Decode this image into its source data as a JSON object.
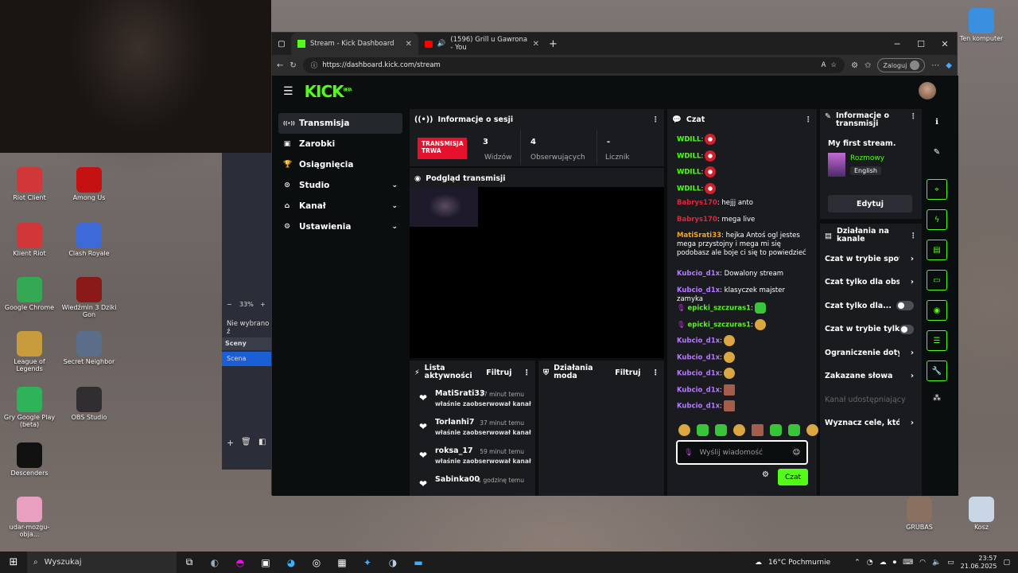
{
  "desktop": {
    "icons": [
      {
        "label": "Riot Client",
        "color": "#d13639"
      },
      {
        "label": "Among Us",
        "color": "#c51111"
      },
      {
        "label": "Klient Riot",
        "color": "#d13639"
      },
      {
        "label": "Clash Royale",
        "color": "#3d6ad6"
      },
      {
        "label": "Google Chrome",
        "color": "#34a853"
      },
      {
        "label": "Wiedźmin 3 Dziki Gon",
        "color": "#8a1a1a"
      },
      {
        "label": "League of Legends",
        "color": "#c89b3c"
      },
      {
        "label": "Secret Neighbor",
        "color": "#5a6e8a"
      },
      {
        "label": "Gry Google Play (beta)",
        "color": "#2fb35a"
      },
      {
        "label": "OBS Studio",
        "color": "#302e31"
      },
      {
        "label": "Descenders",
        "color": "#111111"
      },
      {
        "label": "udar-mozgu-obja...",
        "color": "#e9a0c0"
      },
      {
        "label": "Ten komputer",
        "color": "#3a8fe0"
      },
      {
        "label": "GRUBAS",
        "color": "#8a7060"
      },
      {
        "label": "Kosz",
        "color": "#c8d6e6"
      }
    ],
    "obs": {
      "zoom": "33%",
      "no_selection": "Nie wybrano ź",
      "scenes_label": "Sceny",
      "scene": "Scena"
    }
  },
  "browser": {
    "tabs": [
      {
        "title": "Stream - Kick Dashboard"
      },
      {
        "title": "(1596) Grill u Gawrona - You"
      }
    ],
    "url": "https://dashboard.kick.com/stream",
    "login": "Zaloguj"
  },
  "kick": {
    "logo": "KICK",
    "logo_sup": "BETA",
    "nav": [
      {
        "label": "Transmisja",
        "icon": "broadcast-icon"
      },
      {
        "label": "Zarobki",
        "icon": "wallet-icon"
      },
      {
        "label": "Osiągnięcia",
        "icon": "trophy-icon"
      },
      {
        "label": "Studio",
        "icon": "studio-icon"
      },
      {
        "label": "Kanał",
        "icon": "channel-icon"
      },
      {
        "label": "Ustawienia",
        "icon": "gear-icon"
      }
    ],
    "session": {
      "title": "Informacje o sesji",
      "live_badge": "TRANSMISJA TRWA",
      "stats": [
        {
          "value": "3",
          "label": "Widzów"
        },
        {
          "value": "4",
          "label": "Obserwujących"
        },
        {
          "value": "-",
          "label": "Licznik"
        }
      ]
    },
    "preview_title": "Podgląd transmisji",
    "activity": {
      "title": "Lista aktywności",
      "filter": "Filtruj",
      "items": [
        {
          "user": "MatiSrati33",
          "time": "17 minut temu",
          "desc": "właśnie zaobserwował kanał"
        },
        {
          "user": "Torlanhi7",
          "time": "37 minut temu",
          "desc": "właśnie zaobserwował kanał"
        },
        {
          "user": "roksa_17",
          "time": "59 minut temu",
          "desc": "właśnie zaobserwował kanał"
        },
        {
          "user": "Sabinka00",
          "time": "1 godzinę temu",
          "desc": ""
        }
      ]
    },
    "mod_actions": {
      "title": "Działania moda",
      "filter": "Filtruj"
    },
    "chat": {
      "title": "Czat",
      "messages": [
        {
          "user": "WDILL",
          "color": "#53fc18",
          "text": "",
          "emote": "red"
        },
        {
          "user": "WDILL",
          "color": "#53fc18",
          "text": "",
          "emote": "red"
        },
        {
          "user": "WDILL",
          "color": "#53fc18",
          "text": "",
          "emote": "red"
        },
        {
          "user": "WDILL",
          "color": "#53fc18",
          "text": "",
          "emote": "red"
        },
        {
          "user": "Babrys170",
          "color": "#e0273c",
          "text": " hejjj anto",
          "emote": ""
        },
        {
          "user": "Babrys170",
          "color": "#e0273c",
          "text": " mega live",
          "emote": ""
        },
        {
          "user": "MatiSrati33",
          "color": "#f5a623",
          "text": " hejka Antoś ogl jestes mega przystojny i mega mi się podobasz ale boje ci się to powiedzieć",
          "emote": ""
        },
        {
          "user": "Kubcio_d1x",
          "color": "#b57bff",
          "text": " Dowalony stream",
          "emote": ""
        },
        {
          "user": "Kubcio_d1x",
          "color": "#b57bff",
          "text": " klasyczek majster zamyka",
          "emote": ""
        },
        {
          "user": "epicki_szczuras1",
          "color": "#53fc18",
          "text": "",
          "emote": "green"
        },
        {
          "user": "epicki_szczuras1",
          "color": "#53fc18",
          "text": "",
          "emote": "face"
        },
        {
          "user": "Kubcio_d1x",
          "color": "#b57bff",
          "text": "",
          "emote": "face"
        },
        {
          "user": "Kubcio_d1x",
          "color": "#b57bff",
          "text": "",
          "emote": "face"
        },
        {
          "user": "Kubcio_d1x",
          "color": "#b57bff",
          "text": "",
          "emote": "face"
        },
        {
          "user": "Kubcio_d1x",
          "color": "#b57bff",
          "text": "",
          "emote": "pic"
        },
        {
          "user": "Kubcio_d1x",
          "color": "#b57bff",
          "text": "",
          "emote": "pic"
        }
      ],
      "placeholder": "Wyślij wiadomość",
      "send": "Czat"
    },
    "stream_info": {
      "title": "Informacje o transmisji",
      "stream_title": "My first stream.",
      "category": "Rozmowy",
      "language": "English",
      "edit": "Edytuj"
    },
    "channel_actions": {
      "title": "Działania na kanale",
      "items": [
        {
          "label": "Czat w trybie spowolnienia",
          "kind": "arrow"
        },
        {
          "label": "Czat tylko dla obserwujących",
          "kind": "arrow"
        },
        {
          "label": "Czat tylko dla...",
          "kind": "toggle"
        },
        {
          "label": "Czat w trybie tylko...",
          "kind": "toggle"
        },
        {
          "label": "Ograniczenie dotyczące",
          "kind": "arrow"
        },
        {
          "label": "Zakazane słowa",
          "kind": "arrow"
        },
        {
          "label": "Kanał udostępniający",
          "kind": "disabled"
        },
        {
          "label": "Wyznacz cele, które...",
          "kind": "arrow"
        }
      ]
    }
  },
  "taskbar": {
    "search": "Wyszukaj",
    "weather": "16°C Pochmurnie",
    "time": "23:57",
    "date": "21.06.2025"
  }
}
